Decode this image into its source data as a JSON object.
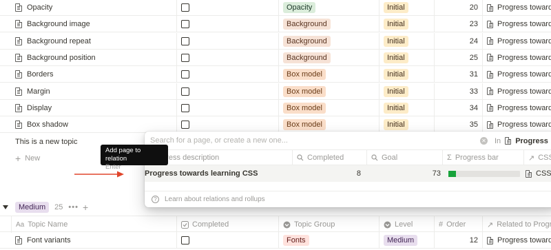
{
  "rows": [
    {
      "name": "Opacity",
      "group": "Opacity",
      "group_color": "green",
      "level": "Initial",
      "order": "20",
      "related": "Progress towards learning CSS"
    },
    {
      "name": "Background image",
      "group": "Background",
      "group_color": "brown",
      "level": "Initial",
      "order": "23",
      "related": "Progress towards learning CSS"
    },
    {
      "name": "Background repeat",
      "group": "Background",
      "group_color": "brown",
      "level": "Initial",
      "order": "24",
      "related": "Progress towards learning CSS"
    },
    {
      "name": "Background position",
      "group": "Background",
      "group_color": "brown",
      "level": "Initial",
      "order": "25",
      "related": "Progress towards learning CSS"
    },
    {
      "name": "Borders",
      "group": "Box model",
      "group_color": "peach",
      "level": "Initial",
      "order": "31",
      "related": "Progress towards learning CSS"
    },
    {
      "name": "Margin",
      "group": "Box model",
      "group_color": "peach",
      "level": "Initial",
      "order": "33",
      "related": "Progress towards learning CSS"
    },
    {
      "name": "Display",
      "group": "Box model",
      "group_color": "peach",
      "level": "Initial",
      "order": "34",
      "related": "Progress towards learning CSS"
    },
    {
      "name": "Box shadow",
      "group": "Box model",
      "group_color": "peach",
      "level": "Initial",
      "order": "35",
      "related": "Progress towards learning CSS"
    }
  ],
  "new_topic": "This is a new topic",
  "new_button": "New",
  "popup": {
    "search_placeholder": "Search for a page, or create a new one...",
    "in_label": "In",
    "database": "Progress",
    "columns": {
      "description": "Progress description",
      "completed": "Completed",
      "goal": "Goal",
      "progress_bar": "Progress bar",
      "css": "CSS"
    },
    "result": {
      "title": "Progress towards learning CSS",
      "completed": "8",
      "goal": "73",
      "progress_fraction": 0.11,
      "css": "CSS"
    },
    "footer": "Learn about relations and rollups"
  },
  "tooltip": {
    "title": "Add page to relation",
    "shortcut": "Enter"
  },
  "group": {
    "label": "Medium",
    "count": "25",
    "more": "•••",
    "add": "+"
  },
  "headers": {
    "topic_name": "Topic Name",
    "completed": "Completed",
    "topic_group": "Topic Group",
    "level": "Level",
    "order": "Order",
    "related": "Related to Progress"
  },
  "bottom_row": {
    "name": "Font variants",
    "group": "Fonts",
    "level": "Medium",
    "order": "12",
    "related": "Progress towards learning CSS"
  },
  "colors": {
    "accent_blue": "#54a0d8",
    "progress_green": "#18a33b",
    "arrow_red": "#e0452b"
  }
}
